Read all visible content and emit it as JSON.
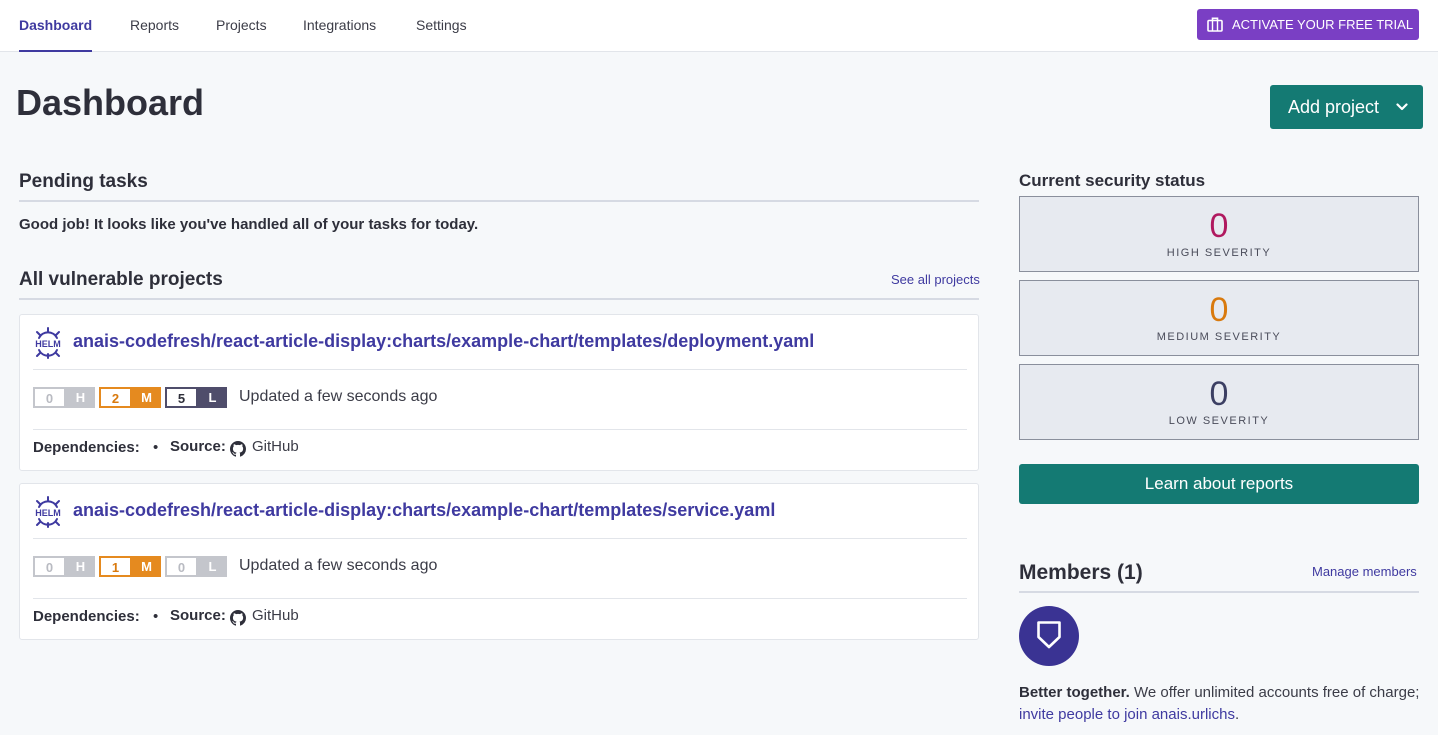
{
  "nav": {
    "tabs": [
      {
        "label": "Dashboard",
        "active": true
      },
      {
        "label": "Reports",
        "active": false
      },
      {
        "label": "Projects",
        "active": false
      },
      {
        "label": "Integrations",
        "active": false
      },
      {
        "label": "Settings",
        "active": false
      }
    ],
    "trial_button": "ACTIVATE YOUR FREE TRIAL",
    "trial_icon": "briefcase-icon"
  },
  "page": {
    "title": "Dashboard",
    "add_project_label": "Add project"
  },
  "pending": {
    "heading": "Pending tasks",
    "message": "Good job! It looks like you've handled all of your tasks for today."
  },
  "vulnerable": {
    "heading": "All vulnerable projects",
    "see_all": "See all projects",
    "projects": [
      {
        "icon": "helm-icon",
        "name": "anais-codefresh/react-article-display:charts/example-chart/templates/deployment.yaml",
        "high": "0",
        "high_letter": "H",
        "medium": "2",
        "medium_letter": "M",
        "low": "5",
        "low_letter": "L",
        "updated": "Updated a few seconds ago",
        "deps_label": "Dependencies:",
        "separator": "•",
        "source_label": "Source:",
        "source": "GitHub"
      },
      {
        "icon": "helm-icon",
        "name": "anais-codefresh/react-article-display:charts/example-chart/templates/service.yaml",
        "high": "0",
        "high_letter": "H",
        "medium": "1",
        "medium_letter": "M",
        "low": "0",
        "low_letter": "L",
        "updated": "Updated a few seconds ago",
        "deps_label": "Dependencies:",
        "separator": "•",
        "source_label": "Source:",
        "source": "GitHub"
      }
    ]
  },
  "security": {
    "heading": "Current security status",
    "high": {
      "value": "0",
      "label": "HIGH SEVERITY",
      "color": "#b0195f"
    },
    "medium": {
      "value": "0",
      "label": "MEDIUM SEVERITY",
      "color": "#d97a0e"
    },
    "low": {
      "value": "0",
      "label": "LOW SEVERITY",
      "color": "#3c3f63"
    },
    "learn_button": "Learn about reports"
  },
  "members": {
    "heading": "Members (1)",
    "manage": "Manage members",
    "avatar_icon": "shield-icon",
    "better_bold": "Better together.",
    "better_text": " We offer unlimited accounts free of charge; ",
    "invite_link": "invite people to join anais.urlichs",
    "end": "."
  },
  "colors": {
    "brand_purple": "#3f3aa0",
    "trial_purple": "#7a3fc4",
    "teal": "#147a73",
    "medium_orange": "#e58a1f",
    "low_navy": "#4f4d6b"
  }
}
